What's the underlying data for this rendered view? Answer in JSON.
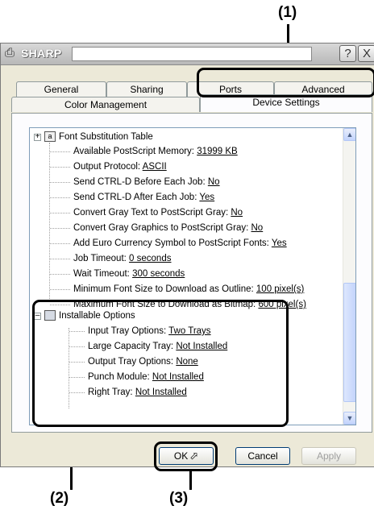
{
  "callouts": [
    "(1)",
    "(2)",
    "(3)"
  ],
  "window": {
    "title": "SHARP",
    "help_glyph": "?",
    "close_glyph": "X"
  },
  "tabs": {
    "row1": [
      "General",
      "Sharing",
      "Ports",
      "Advanced"
    ],
    "row2": [
      "Color Management",
      "Device Settings"
    ],
    "active": "Device Settings"
  },
  "tree": {
    "group1": {
      "label": "Font Substitution Table"
    },
    "items1": [
      {
        "label": "Available PostScript Memory: ",
        "value": "31999 KB"
      },
      {
        "label": "Output Protocol: ",
        "value": "ASCII"
      },
      {
        "label": "Send CTRL-D Before Each Job: ",
        "value": "No"
      },
      {
        "label": "Send CTRL-D After Each Job: ",
        "value": "Yes"
      },
      {
        "label": "Convert Gray Text to PostScript Gray: ",
        "value": "No"
      },
      {
        "label": "Convert Gray Graphics to PostScript Gray: ",
        "value": "No"
      },
      {
        "label": "Add Euro Currency Symbol to PostScript Fonts: ",
        "value": "Yes"
      },
      {
        "label": "Job Timeout: ",
        "value": "0 seconds"
      },
      {
        "label": "Wait Timeout: ",
        "value": "300 seconds"
      },
      {
        "label": "Minimum Font Size to Download as Outline: ",
        "value": "100 pixel(s)"
      },
      {
        "label": "Maximum Font Size to Download as Bitmap: ",
        "value": "600 pixel(s)"
      }
    ],
    "group2": {
      "label": "Installable Options"
    },
    "items2": [
      {
        "label": "Input Tray Options: ",
        "value": "Two Trays"
      },
      {
        "label": "Large Capacity Tray: ",
        "value": "Not Installed"
      },
      {
        "label": "Output Tray Options: ",
        "value": "None"
      },
      {
        "label": "Punch Module: ",
        "value": "Not Installed"
      },
      {
        "label": "Right Tray: ",
        "value": "Not Installed"
      }
    ]
  },
  "buttons": {
    "ok": "OK",
    "cancel": "Cancel",
    "apply": "Apply"
  }
}
